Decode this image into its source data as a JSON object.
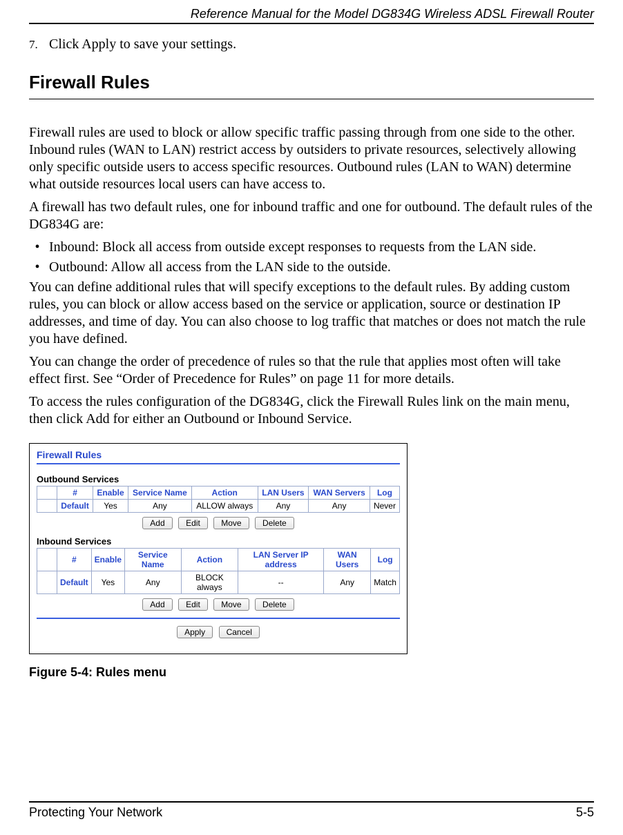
{
  "header": {
    "title": "Reference Manual for the Model DG834G Wireless ADSL Firewall Router"
  },
  "step": {
    "number": "7.",
    "text": "Click Apply to save your settings."
  },
  "section": {
    "title": "Firewall Rules"
  },
  "paragraphs": {
    "p1": "Firewall rules are used to block or allow specific traffic passing through from one side to the other. Inbound rules (WAN to LAN) restrict access by outsiders to private resources, selectively allowing only specific outside users to access specific resources. Outbound rules (LAN to WAN) determine what outside resources local users can have access to.",
    "p2": "A firewall has two default rules, one for inbound traffic and one for outbound. The default rules of the DG834G are:",
    "b1": "Inbound: Block all access from outside except responses to requests from the LAN side.",
    "b2": "Outbound: Allow all access from the LAN side to the outside.",
    "p3": "You can define additional rules that will specify exceptions to the default rules. By adding custom rules, you can block or allow access based on the service or application, source or destination IP addresses, and time of day. You can also choose to log traffic that matches or does not match the rule you have defined.",
    "p4": "You can change the order of precedence of rules so that the rule that applies most often will take effect first. See “Order of Precedence for Rules” on page 11 for more details.",
    "p5": "To access the rules configuration of the DG834G, click the Firewall Rules link on the main menu, then click Add for either an Outbound or Inbound Service."
  },
  "firewall_ui": {
    "title": "Firewall Rules",
    "outbound": {
      "label": "Outbound Services",
      "headers": [
        "",
        "#",
        "Enable",
        "Service Name",
        "Action",
        "LAN Users",
        "WAN Servers",
        "Log"
      ],
      "row": [
        "",
        "Default",
        "Yes",
        "Any",
        "ALLOW always",
        "Any",
        "Any",
        "Never"
      ]
    },
    "inbound": {
      "label": "Inbound Services",
      "headers": [
        "",
        "#",
        "Enable",
        "Service Name",
        "Action",
        "LAN Server IP address",
        "WAN Users",
        "Log"
      ],
      "row": [
        "",
        "Default",
        "Yes",
        "Any",
        "BLOCK always",
        "--",
        "Any",
        "Match"
      ]
    },
    "buttons": {
      "add": "Add",
      "edit": "Edit",
      "move": "Move",
      "delete": "Delete",
      "apply": "Apply",
      "cancel": "Cancel"
    }
  },
  "figure_caption": "Figure 5-4:  Rules menu",
  "footer": {
    "left": "Protecting Your Network",
    "right": "5-5"
  }
}
